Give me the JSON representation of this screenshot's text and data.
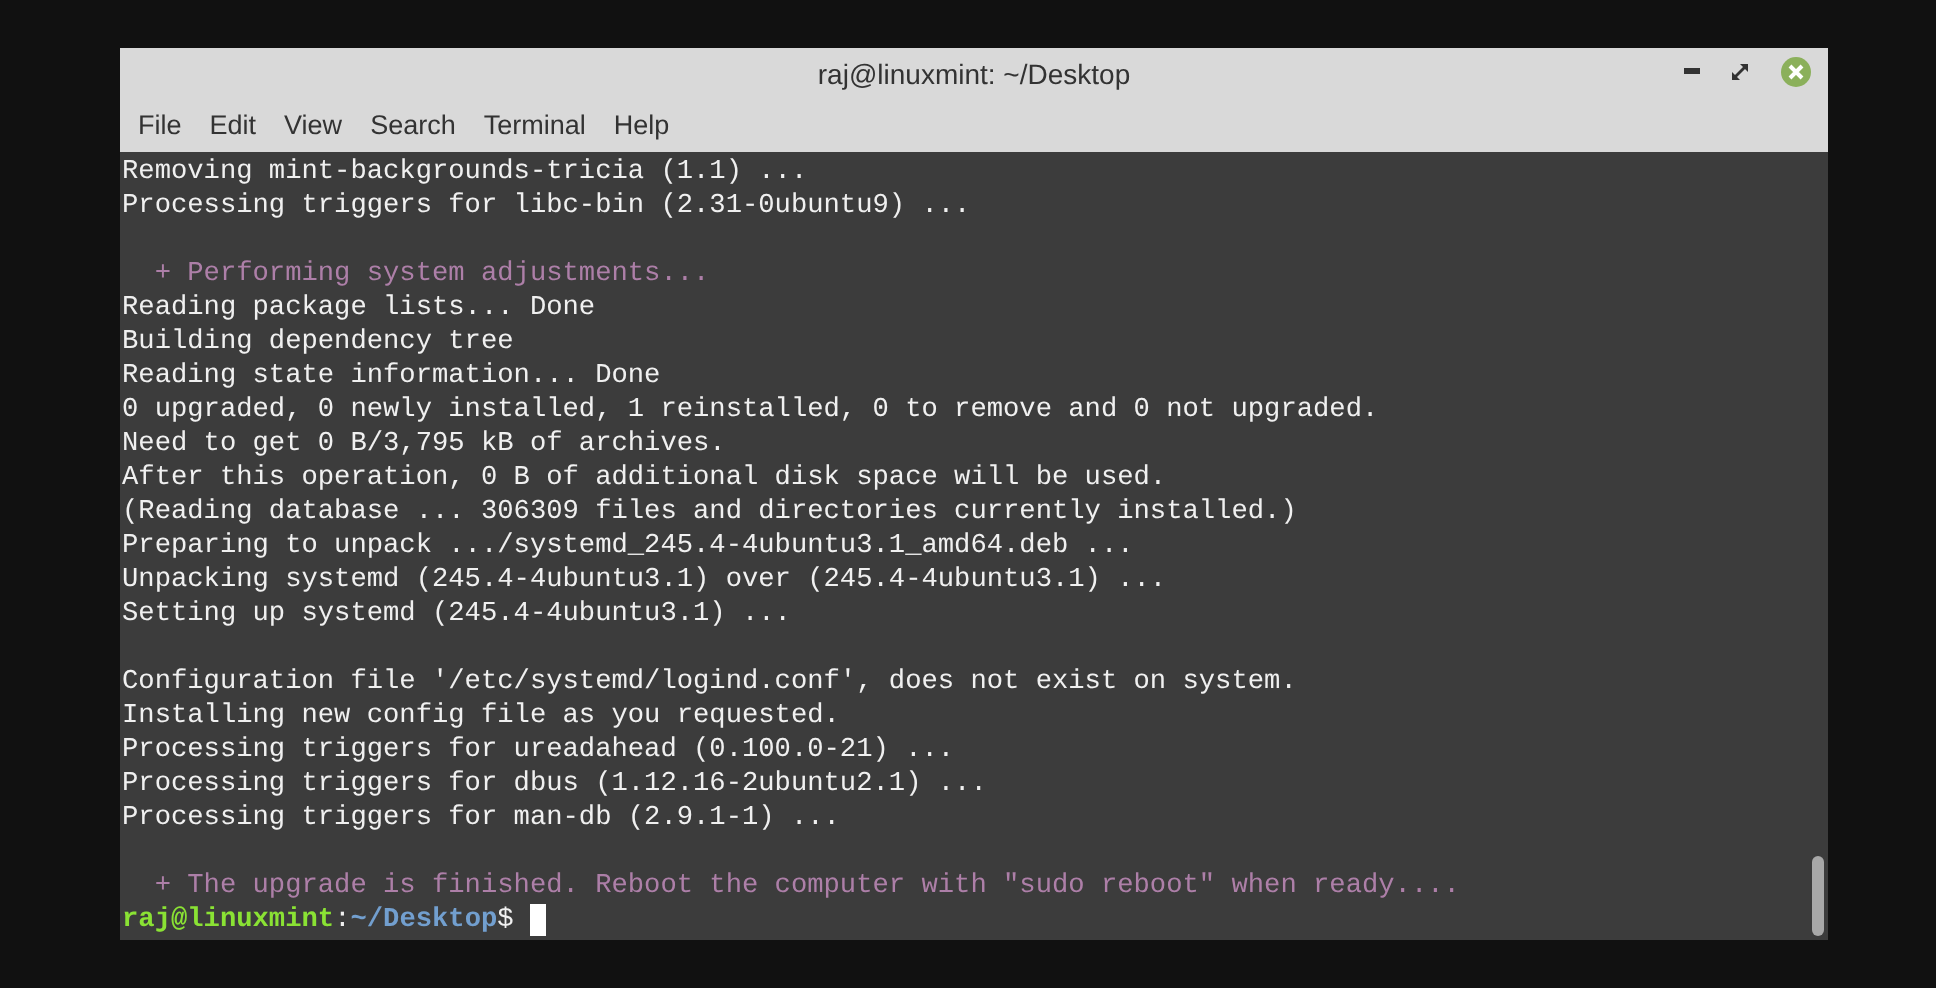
{
  "window": {
    "title": "raj@linuxmint: ~/Desktop"
  },
  "menu": [
    "File",
    "Edit",
    "View",
    "Search",
    "Terminal",
    "Help"
  ],
  "lines": [
    {
      "kind": "output",
      "text": "Removing mint-backgrounds-tricia (1.1) ..."
    },
    {
      "kind": "output",
      "text": "Processing triggers for libc-bin (2.31-0ubuntu9) ..."
    },
    {
      "kind": "blank"
    },
    {
      "kind": "notice",
      "text": "  + Performing system adjustments..."
    },
    {
      "kind": "output",
      "text": "Reading package lists... Done"
    },
    {
      "kind": "output",
      "text": "Building dependency tree"
    },
    {
      "kind": "output",
      "text": "Reading state information... Done"
    },
    {
      "kind": "output",
      "text": "0 upgraded, 0 newly installed, 1 reinstalled, 0 to remove and 0 not upgraded."
    },
    {
      "kind": "output",
      "text": "Need to get 0 B/3,795 kB of archives."
    },
    {
      "kind": "output",
      "text": "After this operation, 0 B of additional disk space will be used."
    },
    {
      "kind": "output",
      "text": "(Reading database ... 306309 files and directories currently installed.)"
    },
    {
      "kind": "output",
      "text": "Preparing to unpack .../systemd_245.4-4ubuntu3.1_amd64.deb ..."
    },
    {
      "kind": "output",
      "text": "Unpacking systemd (245.4-4ubuntu3.1) over (245.4-4ubuntu3.1) ..."
    },
    {
      "kind": "output",
      "text": "Setting up systemd (245.4-4ubuntu3.1) ..."
    },
    {
      "kind": "blank"
    },
    {
      "kind": "output",
      "text": "Configuration file '/etc/systemd/logind.conf', does not exist on system."
    },
    {
      "kind": "output",
      "text": "Installing new config file as you requested."
    },
    {
      "kind": "output",
      "text": "Processing triggers for ureadahead (0.100.0-21) ..."
    },
    {
      "kind": "output",
      "text": "Processing triggers for dbus (1.12.16-2ubuntu2.1) ..."
    },
    {
      "kind": "output",
      "text": "Processing triggers for man-db (2.9.1-1) ..."
    },
    {
      "kind": "blank"
    },
    {
      "kind": "notice",
      "text": "  + The upgrade is finished. Reboot the computer with \"sudo reboot\" when ready...."
    },
    {
      "kind": "prompt",
      "user": "raj@linuxmint",
      "colon": ":",
      "path": "~/Desktop",
      "symbol": "$"
    }
  ]
}
